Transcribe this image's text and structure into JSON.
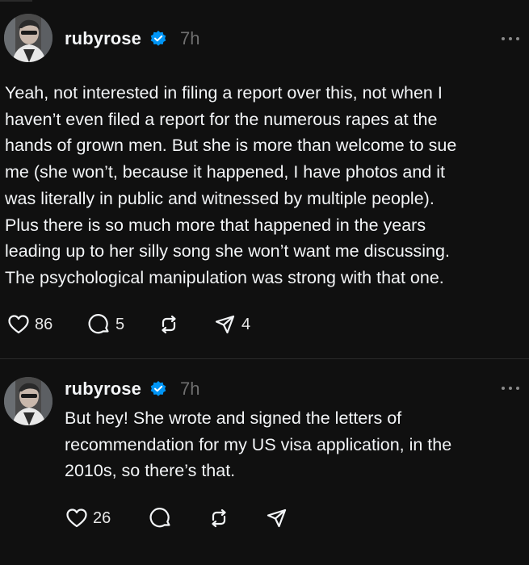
{
  "posts": [
    {
      "username": "rubyrose",
      "time": "7h",
      "text": "Yeah, not interested in filing a report over this, not when I\nhaven’t even filed a report for the numerous rapes at the\nhands of grown men. But she is more than welcome to sue\nme (she won’t, because it happened, I have photos and it\nwas literally in public and witnessed by multiple people).\nPlus there is so much more that happened in the years\nleading up to her silly song she won’t want me discussing.\nThe psychological manipulation was strong with that one.",
      "likes": "86",
      "replies": "5",
      "reposts": "",
      "shares": "4"
    },
    {
      "username": "rubyrose",
      "time": "7h",
      "text": "But hey! She wrote and signed the letters of\nrecommendation for my US visa application, in the\n2010s, so there’s that.",
      "likes": "26",
      "replies": "",
      "reposts": "",
      "shares": ""
    }
  ],
  "colors": {
    "background": "#101010",
    "text": "#f3f5f7",
    "muted": "#6f6f6f",
    "verified": "#0095f6"
  },
  "icons": [
    "heart-icon",
    "reply-icon",
    "repost-icon",
    "share-icon",
    "more-icon",
    "verified-icon"
  ]
}
